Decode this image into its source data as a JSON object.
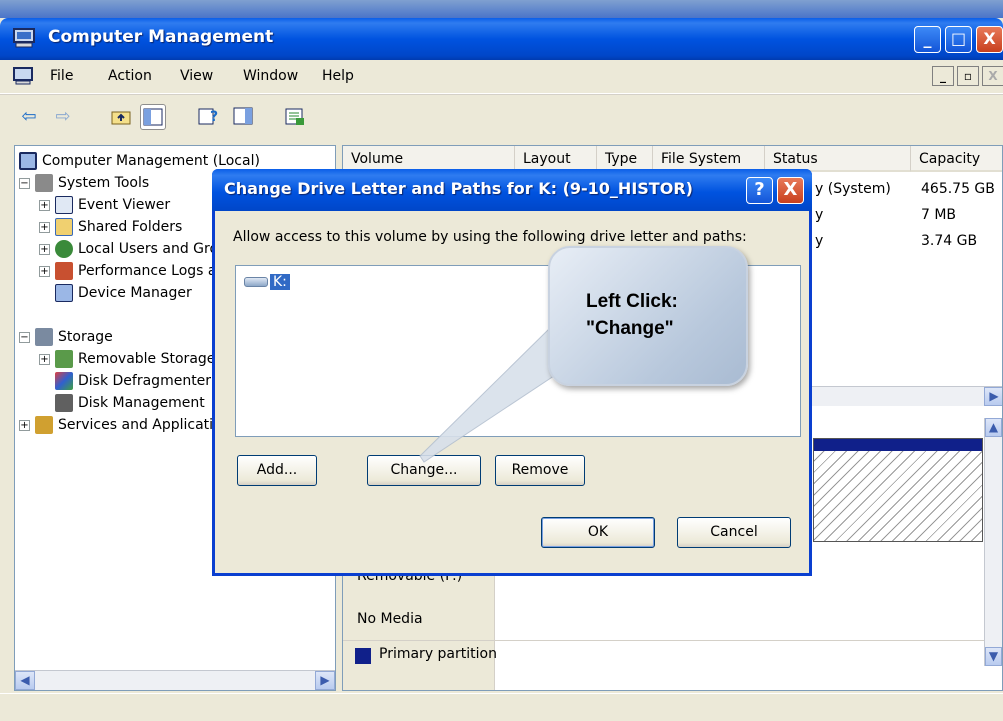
{
  "window": {
    "title": "Computer Management",
    "controls": {
      "minimize": "_",
      "maximize": "□",
      "close": "X"
    },
    "mdi_controls": {
      "minimize": "_",
      "restore": "▫",
      "close": "X"
    }
  },
  "menu": [
    "File",
    "Action",
    "View",
    "Window",
    "Help"
  ],
  "toolbar": [
    "back-arrow",
    "forward-arrow",
    "up-folder",
    "show-hide-tree",
    "help",
    "properties-panel",
    "export-list"
  ],
  "tree": [
    {
      "label": "Computer Management (Local)",
      "level": 0,
      "expander": "",
      "icon": "computer-icon"
    },
    {
      "label": "System Tools",
      "level": 1,
      "expander": "−",
      "icon": "tools-icon"
    },
    {
      "label": "Event Viewer",
      "level": 2,
      "expander": "+",
      "icon": "event-viewer-icon"
    },
    {
      "label": "Shared Folders",
      "level": 2,
      "expander": "+",
      "icon": "shared-folder-icon"
    },
    {
      "label": "Local Users and Groups",
      "level": 2,
      "expander": "+",
      "icon": "users-icon"
    },
    {
      "label": "Performance Logs and Alerts",
      "level": 2,
      "expander": "+",
      "icon": "performance-icon"
    },
    {
      "label": "Device Manager",
      "level": 2,
      "expander": "",
      "icon": "device-manager-icon"
    },
    {
      "label": "Storage",
      "level": 1,
      "expander": "−",
      "icon": "storage-icon"
    },
    {
      "label": "Removable Storage",
      "level": 2,
      "expander": "+",
      "icon": "removable-storage-icon"
    },
    {
      "label": "Disk Defragmenter",
      "level": 2,
      "expander": "",
      "icon": "defrag-icon"
    },
    {
      "label": "Disk Management",
      "level": 2,
      "expander": "",
      "icon": "disk-management-icon"
    },
    {
      "label": "Services and Applications",
      "level": 1,
      "expander": "+",
      "icon": "services-icon"
    }
  ],
  "columns": [
    "Volume",
    "Layout",
    "Type",
    "File System",
    "Status",
    "Capacity"
  ],
  "rows": [
    {
      "status_tail": "y (System)",
      "capacity": "465.75 GB"
    },
    {
      "status_tail": "y",
      "capacity": "7 MB"
    },
    {
      "status_tail": "y",
      "capacity": "3.74 GB"
    }
  ],
  "lower_pane": {
    "removable": "Removable (F:)",
    "no_media": "No Media",
    "legend": "Primary partition"
  },
  "dialog": {
    "title": "Change Drive Letter and Paths for K: (9-10_HISTOR)",
    "help_btn": "?",
    "close_btn": "X",
    "instruction": "Allow access to this volume by using the following drive letter and paths:",
    "list_items": [
      "K:"
    ],
    "buttons": {
      "add": "Add...",
      "change": "Change...",
      "remove": "Remove",
      "ok": "OK",
      "cancel": "Cancel"
    }
  },
  "callout": {
    "text": "Left Click:\n\"Change\""
  },
  "colors": {
    "xp_blue": "#0053e0",
    "selection": "#316ac5",
    "legend_primary": "#10208a"
  }
}
